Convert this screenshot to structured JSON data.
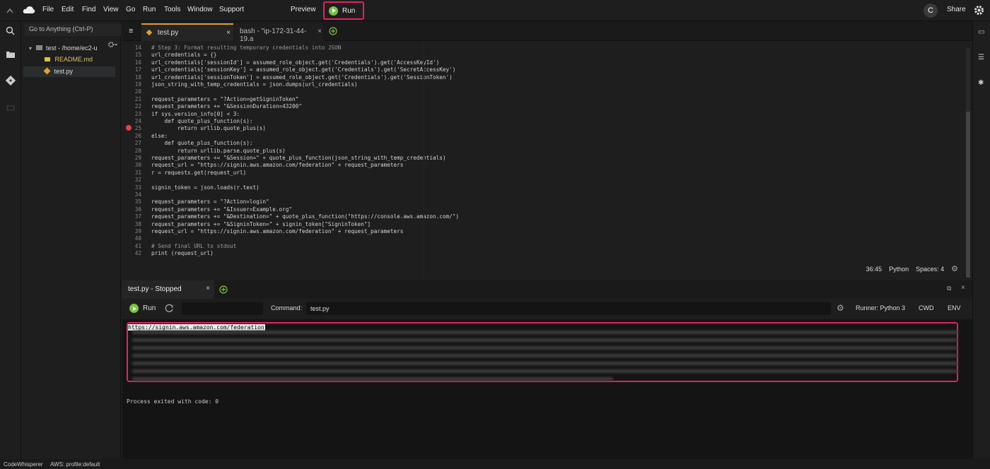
{
  "menubar": {
    "items": [
      "File",
      "Edit",
      "Find",
      "View",
      "Go",
      "Run",
      "Tools",
      "Window",
      "Support"
    ],
    "preview": "Preview",
    "run": "Run",
    "avatar": "C",
    "share": "Share"
  },
  "sidebar": {
    "goto": "Go to Anything (Ctrl-P)",
    "root": "test - /home/ec2-u",
    "files": [
      "README.md",
      "test.py"
    ]
  },
  "editor": {
    "tabs": [
      "test.py",
      "bash - \"ip-172-31-44-19.a"
    ],
    "lines": [
      {
        "n": "14",
        "t": "# Step 3: Format resulting temporary credentials into JSON"
      },
      {
        "n": "15",
        "t": "url_credentials = {}"
      },
      {
        "n": "16",
        "t": "url_credentials['sessionId'] = assumed_role_object.get('Credentials').get('AccessKeyId')"
      },
      {
        "n": "17",
        "t": "url_credentials['sessionKey'] = assumed_role_object.get('Credentials').get('SecretAccessKey')"
      },
      {
        "n": "18",
        "t": "url_credentials['sessionToken'] = assumed_role_object.get('Credentials').get('SessionToken')"
      },
      {
        "n": "19",
        "t": "json_string_with_temp_credentials = json.dumps(url_credentials)"
      },
      {
        "n": "20",
        "t": ""
      },
      {
        "n": "21",
        "t": "request_parameters = \"?Action=getSigninToken\""
      },
      {
        "n": "22",
        "t": "request_parameters += \"&SessionDuration=43200\""
      },
      {
        "n": "23",
        "t": "if sys.version_info[0] < 3:"
      },
      {
        "n": "24",
        "t": "    def quote_plus_function(s):"
      },
      {
        "n": "25",
        "t": "        return urllib.quote_plus(s)"
      },
      {
        "n": "26",
        "t": "else:"
      },
      {
        "n": "27",
        "t": "    def quote_plus_function(s):"
      },
      {
        "n": "28",
        "t": "        return urllib.parse.quote_plus(s)"
      },
      {
        "n": "29",
        "t": "request_parameters += \"&Session=\" + quote_plus_function(json_string_with_temp_credentials)"
      },
      {
        "n": "30",
        "t": "request_url = \"https://signin.aws.amazon.com/federation\" + request_parameters"
      },
      {
        "n": "31",
        "t": "r = requests.get(request_url)"
      },
      {
        "n": "32",
        "t": ""
      },
      {
        "n": "33",
        "t": "signin_token = json.loads(r.text)"
      },
      {
        "n": "34",
        "t": ""
      },
      {
        "n": "35",
        "t": "request_parameters = \"?Action=login\""
      },
      {
        "n": "36",
        "t": "request_parameters += \"&Issuer=Example.org\""
      },
      {
        "n": "37",
        "t": "request_parameters += \"&Destination=\" + quote_plus_function(\"https://console.aws.amazon.com/\")"
      },
      {
        "n": "38",
        "t": "request_parameters += \"&SigninToken=\" + signin_token[\"SigninToken\"]"
      },
      {
        "n": "39",
        "t": "request_url = \"https://signin.aws.amazon.com/federation\" + request_parameters"
      },
      {
        "n": "40",
        "t": ""
      },
      {
        "n": "41",
        "t": "# Send final URL to stdout"
      },
      {
        "n": "42",
        "t": "print (request_url)"
      }
    ],
    "status": {
      "cursor": "36:45",
      "language": "Python",
      "spaces": "Spaces: 4"
    }
  },
  "runner": {
    "tab": "test.py - Stopped",
    "run": "Run",
    "command_label": "Command:",
    "command": "test.py",
    "runner": "Runner: Python 3",
    "cwd": "CWD",
    "env": "ENV",
    "output_url": "https://signin.aws.amazon.com/federation",
    "exit": "Process exited with code: 0"
  },
  "bottom": {
    "left": "CodeWhisperer",
    "right": "AWS: profile:default"
  },
  "colors": {
    "accent": "#e0245e",
    "run_green": "#7ac143"
  }
}
